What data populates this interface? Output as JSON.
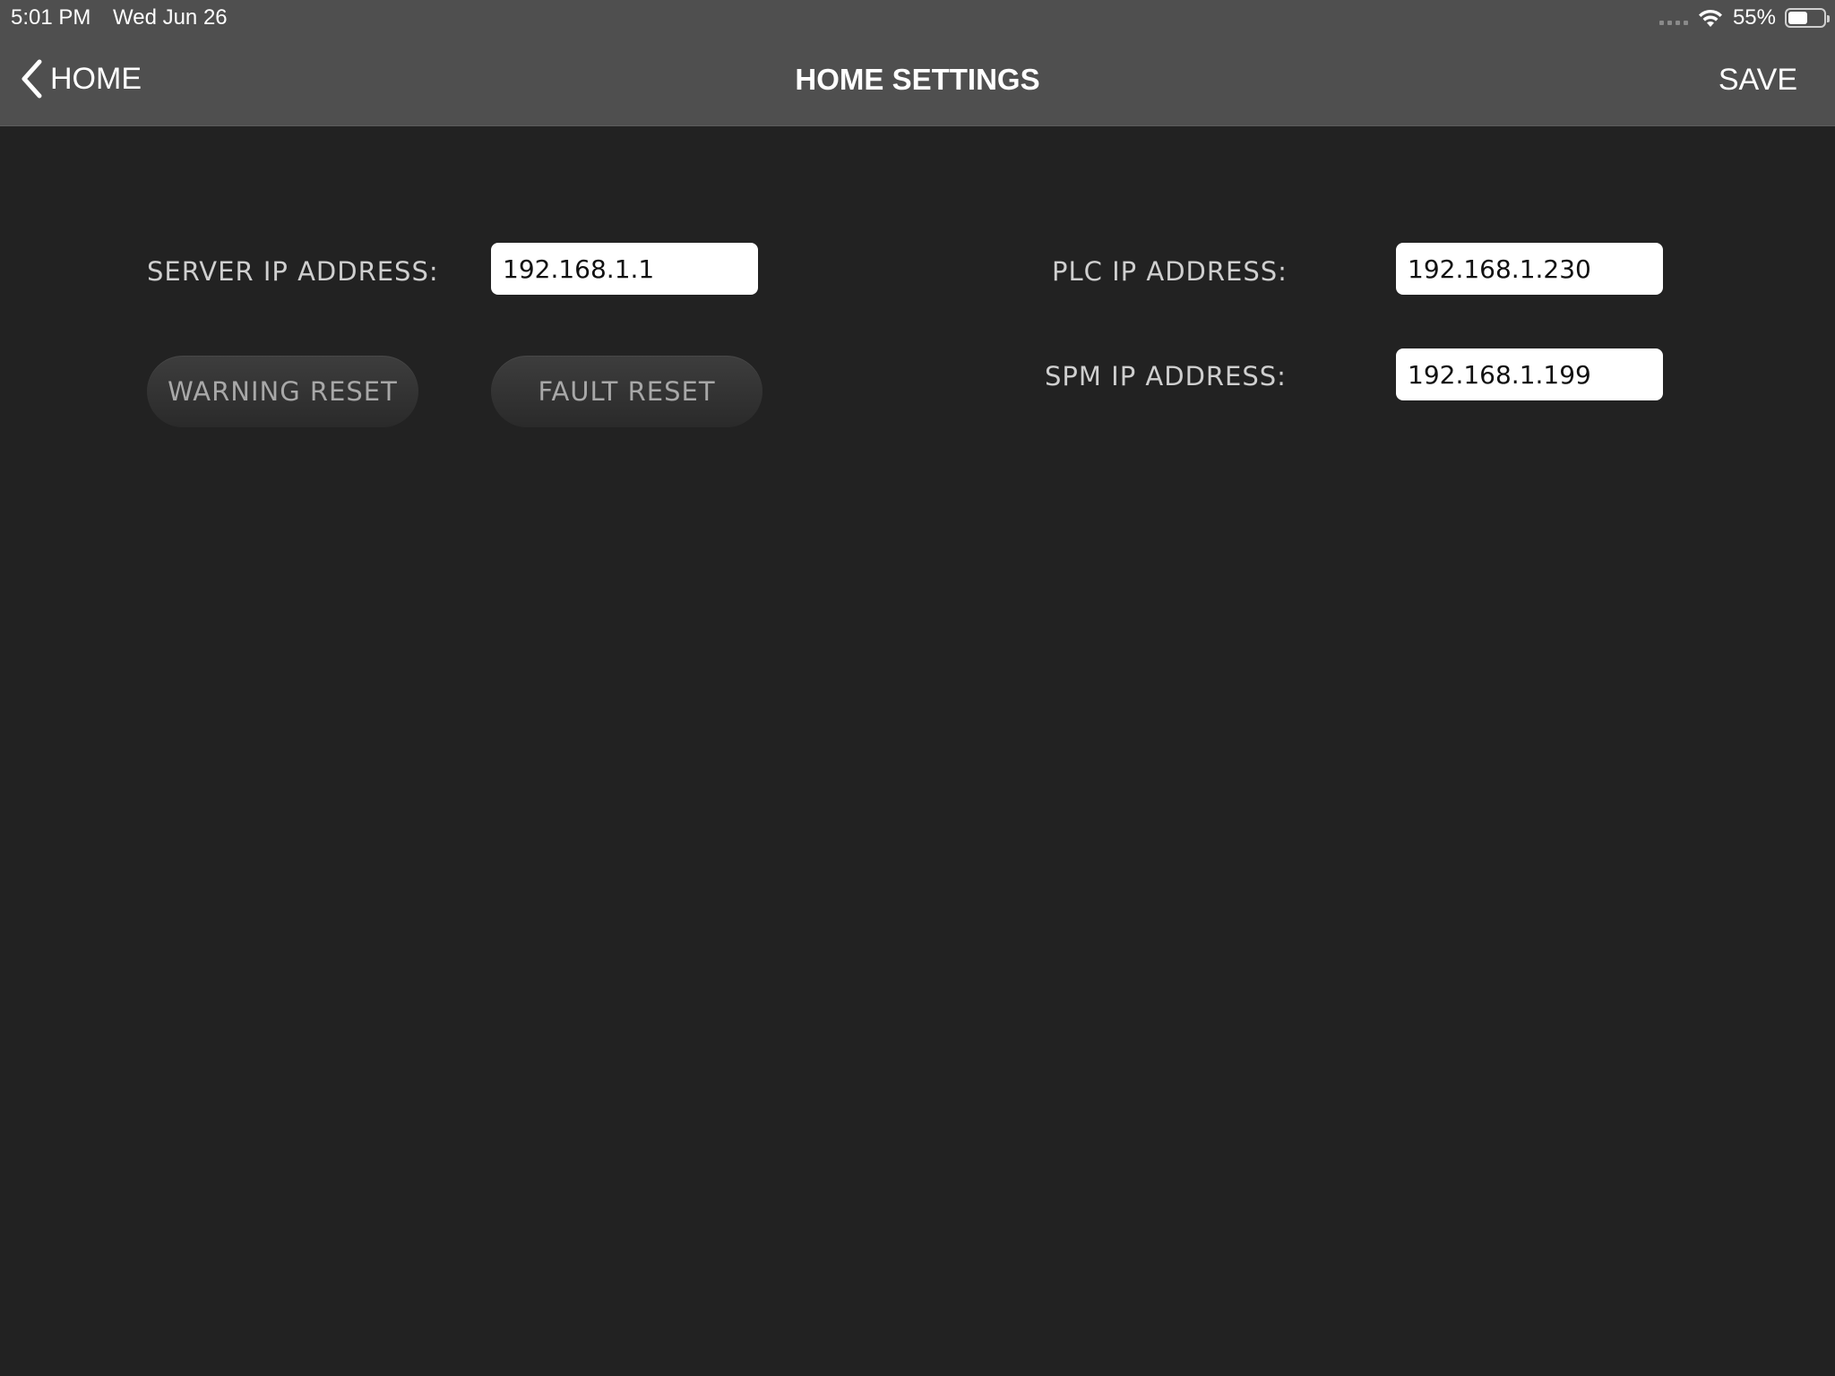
{
  "status_bar": {
    "time": "5:01 PM",
    "date": "Wed Jun 26",
    "battery_percent_label": "55%",
    "battery_level": 0.55,
    "icons": [
      "cellular-signal-icon",
      "wifi-icon",
      "battery-icon"
    ]
  },
  "nav": {
    "back_label": "HOME",
    "back_icon": "chevron-left-icon",
    "title": "HOME SETTINGS",
    "save_label": "SAVE"
  },
  "settings": {
    "server_ip": {
      "label": "SERVER IP ADDRESS:",
      "value": "192.168.1.1"
    },
    "plc_ip": {
      "label": "PLC IP ADDRESS:",
      "value": "192.168.1.230"
    },
    "spm_ip": {
      "label": "SPM IP ADDRESS:",
      "value": "192.168.1.199"
    }
  },
  "actions": {
    "warning_reset_label": "WARNING RESET",
    "fault_reset_label": "FAULT RESET"
  },
  "colors": {
    "background": "#222222",
    "bar": "#4f4f4f",
    "label_text": "#cfcfcf",
    "button_text": "#a8a8a8",
    "input_bg": "#ffffff"
  }
}
